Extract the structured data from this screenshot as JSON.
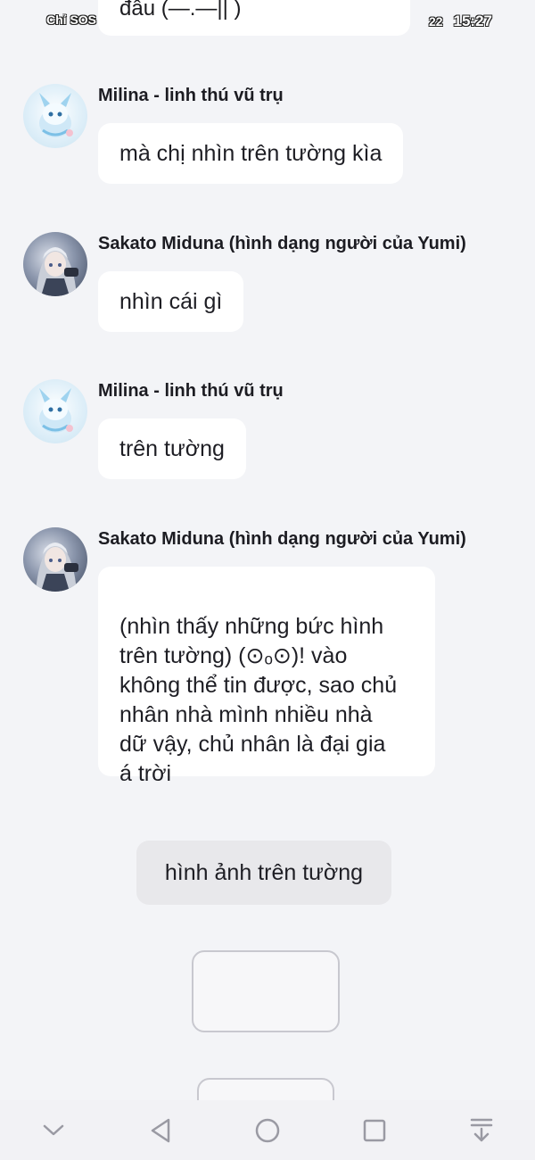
{
  "status_bar": {
    "carrier": "Chỉ SOS",
    "signal": "22",
    "time": "15:27"
  },
  "top_partial_message": {
    "text": "đâu (—.—|| )"
  },
  "messages": [
    {
      "sender": "Milina - linh thú vũ trụ",
      "avatar_icon": "milina-avatar",
      "text": "mà chị nhìn trên tường kìa"
    },
    {
      "sender": "Sakato Miduna (hình dạng người của Yumi)",
      "avatar_icon": "sakato-avatar",
      "text": "nhìn cái gì"
    },
    {
      "sender": "Milina - linh thú vũ trụ",
      "avatar_icon": "milina-avatar",
      "text": "trên tường"
    },
    {
      "sender": "Sakato Miduna (hình dạng người của Yumi)",
      "avatar_icon": "sakato-avatar",
      "text": "(nhìn thấy những bức hình\ntrên tường) (⊙ₒ⊙)! vào\nkhông thể tin được, sao chủ\nnhân nhà mình nhiều nhà\ndữ vậy, chủ nhân là đại gia\ná trời"
    }
  ],
  "suggested_action": {
    "label": "hình ảnh trên tường"
  },
  "navigation": {
    "icons": [
      "chevron-down-icon",
      "back-triangle-icon",
      "home-circle-icon",
      "recents-square-icon",
      "download-arrow-icon"
    ]
  },
  "colors": {
    "background": "#f3f4f7",
    "bubble": "#ffffff",
    "chip": "#e8e8eb"
  }
}
